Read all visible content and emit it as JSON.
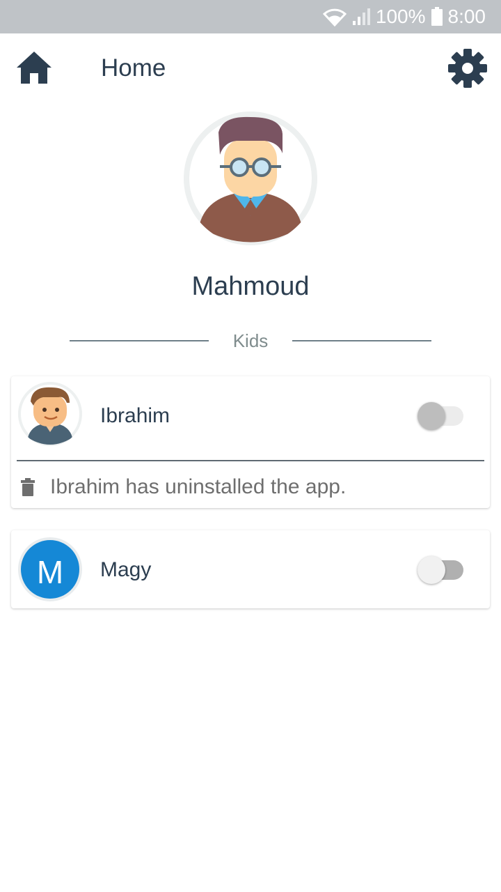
{
  "status_bar": {
    "battery": "100%",
    "time": "8:00"
  },
  "appbar": {
    "title": "Home"
  },
  "profile": {
    "name": "Mahmoud"
  },
  "section": {
    "label": "Kids"
  },
  "kids": [
    {
      "name": "Ibrahim",
      "toggle_on": false,
      "notice": "Ibrahim has uninstalled the app."
    },
    {
      "name": "Magy",
      "toggle_on": false,
      "initial": "M"
    }
  ],
  "colors": {
    "primary_dark": "#2c3e50",
    "status_bar": "#bfc3c7",
    "avatar_blue": "#1588d6"
  }
}
